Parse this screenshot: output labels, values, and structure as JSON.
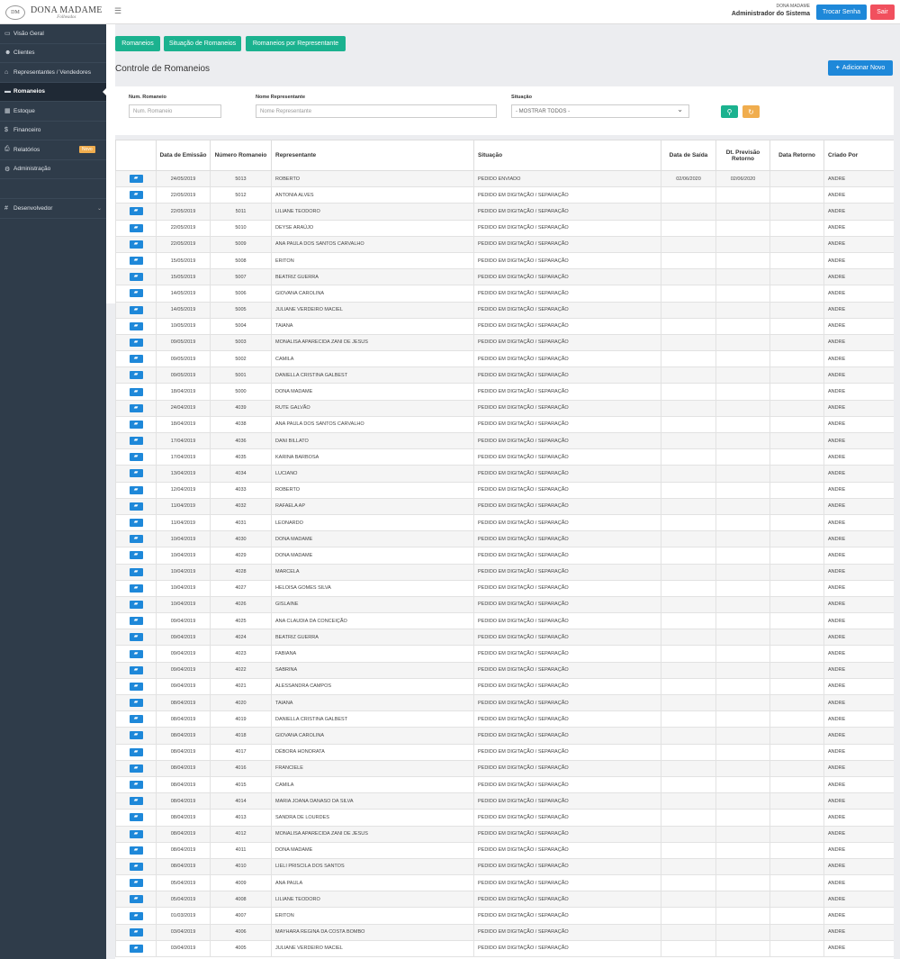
{
  "header": {
    "brand": "DONA MADAME",
    "brand_sub": "Folheados",
    "menu_icon": "hamburger-icon",
    "user_small": "DONA MADAME",
    "user_role": "Administrador do Sistema",
    "btn_change_password": "Trocar Senha",
    "btn_logout": "Sair",
    "colors": {
      "primary": "#1e88d9",
      "danger": "#f1505e",
      "success": "#1bb28f",
      "warning": "#f0ad4e"
    }
  },
  "sidebar": {
    "items": [
      {
        "label": "Visão Geral",
        "icon": "monitor-icon"
      },
      {
        "label": "Clientes",
        "icon": "users-icon"
      },
      {
        "label": "Representantes / Vendedores",
        "icon": "bank-icon"
      },
      {
        "label": "Romaneios",
        "icon": "briefcase-icon"
      },
      {
        "label": "Estoque",
        "icon": "grid-icon"
      },
      {
        "label": "Financeiro",
        "icon": "dollar-icon"
      },
      {
        "label": "Relatórios",
        "icon": "print-icon",
        "badge": "Novo"
      },
      {
        "label": "Administração",
        "icon": "gear-icon"
      }
    ],
    "developer": {
      "label": "Desenvolvedor",
      "icon": "hash-icon"
    }
  },
  "main": {
    "tabs": [
      "Romaneios",
      "Situação de Romaneios",
      "Romaneios por Representante"
    ],
    "title": "Controle de Romaneios",
    "add_button": "Adicionar Novo",
    "filters": {
      "num_label": "Num. Romaneio",
      "num_placeholder": "Num. Romaneio",
      "rep_label": "Nome Representante",
      "rep_placeholder": "Nome Representante",
      "status_label": "Situação",
      "status_value": "- MOSTRAR TODOS -"
    },
    "table": {
      "headers": [
        "",
        "Data de Emissão",
        "Número Romaneio",
        "Representante",
        "Situação",
        "Data de Saída",
        "Dt. Previsão Retorno",
        "Data Retorno",
        "Criado Por"
      ],
      "rows": [
        [
          "24/05/2019",
          "5013",
          "ROBERTO",
          "PEDIDO ENVIADO",
          "02/06/2020",
          "02/06/2020",
          "",
          "ANDRE"
        ],
        [
          "22/05/2019",
          "5012",
          "ANTONIA ALVES",
          "PEDIDO EM DIGITAÇÃO / SEPARAÇÃO",
          "",
          "",
          "",
          "ANDRE"
        ],
        [
          "22/05/2019",
          "5011",
          "LILIANE TEODORO",
          "PEDIDO EM DIGITAÇÃO / SEPARAÇÃO",
          "",
          "",
          "",
          "ANDRE"
        ],
        [
          "22/05/2019",
          "5010",
          "DEYSE ARAÚJO",
          "PEDIDO EM DIGITAÇÃO / SEPARAÇÃO",
          "",
          "",
          "",
          "ANDRE"
        ],
        [
          "22/05/2019",
          "5009",
          "ANA PAULA DOS SANTOS CARVALHO",
          "PEDIDO EM DIGITAÇÃO / SEPARAÇÃO",
          "",
          "",
          "",
          "ANDRE"
        ],
        [
          "15/05/2019",
          "5008",
          "ERITON",
          "PEDIDO EM DIGITAÇÃO / SEPARAÇÃO",
          "",
          "",
          "",
          "ANDRE"
        ],
        [
          "15/05/2019",
          "5007",
          "BEATRIZ GUERRA",
          "PEDIDO EM DIGITAÇÃO / SEPARAÇÃO",
          "",
          "",
          "",
          "ANDRE"
        ],
        [
          "14/05/2019",
          "5006",
          "GIOVANA CAROLINA",
          "PEDIDO EM DIGITAÇÃO / SEPARAÇÃO",
          "",
          "",
          "",
          "ANDRE"
        ],
        [
          "14/05/2019",
          "5005",
          "JULIANE VERDEIRO MACIEL",
          "PEDIDO EM DIGITAÇÃO / SEPARAÇÃO",
          "",
          "",
          "",
          "ANDRE"
        ],
        [
          "10/05/2019",
          "5004",
          "TAIANA",
          "PEDIDO EM DIGITAÇÃO / SEPARAÇÃO",
          "",
          "",
          "",
          "ANDRE"
        ],
        [
          "09/05/2019",
          "5003",
          "MONALISA APARECIDA ZANI DE JESUS",
          "PEDIDO EM DIGITAÇÃO / SEPARAÇÃO",
          "",
          "",
          "",
          "ANDRE"
        ],
        [
          "09/05/2019",
          "5002",
          "CAMILA",
          "PEDIDO EM DIGITAÇÃO / SEPARAÇÃO",
          "",
          "",
          "",
          "ANDRE"
        ],
        [
          "09/05/2019",
          "5001",
          "DANIELLA CRISTINA GALBEST",
          "PEDIDO EM DIGITAÇÃO / SEPARAÇÃO",
          "",
          "",
          "",
          "ANDRE"
        ],
        [
          "18/04/2019",
          "5000",
          "DONA MADAME",
          "PEDIDO EM DIGITAÇÃO / SEPARAÇÃO",
          "",
          "",
          "",
          "ANDRE"
        ],
        [
          "24/04/2019",
          "4039",
          "RUTE GALVÃO",
          "PEDIDO EM DIGITAÇÃO / SEPARAÇÃO",
          "",
          "",
          "",
          "ANDRE"
        ],
        [
          "18/04/2019",
          "4038",
          "ANA PAULA DOS SANTOS CARVALHO",
          "PEDIDO EM DIGITAÇÃO / SEPARAÇÃO",
          "",
          "",
          "",
          "ANDRE"
        ],
        [
          "17/04/2019",
          "4036",
          "DANI BILLATO",
          "PEDIDO EM DIGITAÇÃO / SEPARAÇÃO",
          "",
          "",
          "",
          "ANDRE"
        ],
        [
          "17/04/2019",
          "4035",
          "KARINA BARBOSA",
          "PEDIDO EM DIGITAÇÃO / SEPARAÇÃO",
          "",
          "",
          "",
          "ANDRE"
        ],
        [
          "13/04/2019",
          "4034",
          "LUCIANO",
          "PEDIDO EM DIGITAÇÃO / SEPARAÇÃO",
          "",
          "",
          "",
          "ANDRE"
        ],
        [
          "12/04/2019",
          "4033",
          "ROBERTO",
          "PEDIDO EM DIGITAÇÃO / SEPARAÇÃO",
          "",
          "",
          "",
          "ANDRE"
        ],
        [
          "11/04/2019",
          "4032",
          "RAFAELA AP",
          "PEDIDO EM DIGITAÇÃO / SEPARAÇÃO",
          "",
          "",
          "",
          "ANDRE"
        ],
        [
          "11/04/2019",
          "4031",
          "LEONARDO",
          "PEDIDO EM DIGITAÇÃO / SEPARAÇÃO",
          "",
          "",
          "",
          "ANDRE"
        ],
        [
          "10/04/2019",
          "4030",
          "DONA MADAME",
          "PEDIDO EM DIGITAÇÃO / SEPARAÇÃO",
          "",
          "",
          "",
          "ANDRE"
        ],
        [
          "10/04/2019",
          "4029",
          "DONA MADAME",
          "PEDIDO EM DIGITAÇÃO / SEPARAÇÃO",
          "",
          "",
          "",
          "ANDRE"
        ],
        [
          "10/04/2019",
          "4028",
          "MARCELA",
          "PEDIDO EM DIGITAÇÃO / SEPARAÇÃO",
          "",
          "",
          "",
          "ANDRE"
        ],
        [
          "10/04/2019",
          "4027",
          "HELOISA GOMES SILVA",
          "PEDIDO EM DIGITAÇÃO / SEPARAÇÃO",
          "",
          "",
          "",
          "ANDRE"
        ],
        [
          "10/04/2019",
          "4026",
          "GISLAINE",
          "PEDIDO EM DIGITAÇÃO / SEPARAÇÃO",
          "",
          "",
          "",
          "ANDRE"
        ],
        [
          "09/04/2019",
          "4025",
          "ANA CLAUDIA DA CONCEIÇÃO",
          "PEDIDO EM DIGITAÇÃO / SEPARAÇÃO",
          "",
          "",
          "",
          "ANDRE"
        ],
        [
          "09/04/2019",
          "4024",
          "BEATRIZ GUERRA",
          "PEDIDO EM DIGITAÇÃO / SEPARAÇÃO",
          "",
          "",
          "",
          "ANDRE"
        ],
        [
          "09/04/2019",
          "4023",
          "FABIANA",
          "PEDIDO EM DIGITAÇÃO / SEPARAÇÃO",
          "",
          "",
          "",
          "ANDRE"
        ],
        [
          "09/04/2019",
          "4022",
          "SABRINA",
          "PEDIDO EM DIGITAÇÃO / SEPARAÇÃO",
          "",
          "",
          "",
          "ANDRE"
        ],
        [
          "09/04/2019",
          "4021",
          "ALESSANDRA CAMPOS",
          "PEDIDO EM DIGITAÇÃO / SEPARAÇÃO",
          "",
          "",
          "",
          "ANDRE"
        ],
        [
          "08/04/2019",
          "4020",
          "TAIANA",
          "PEDIDO EM DIGITAÇÃO / SEPARAÇÃO",
          "",
          "",
          "",
          "ANDRE"
        ],
        [
          "08/04/2019",
          "4019",
          "DANIELLA CRISTINA GALBEST",
          "PEDIDO EM DIGITAÇÃO / SEPARAÇÃO",
          "",
          "",
          "",
          "ANDRE"
        ],
        [
          "08/04/2019",
          "4018",
          "GIOVANA CAROLINA",
          "PEDIDO EM DIGITAÇÃO / SEPARAÇÃO",
          "",
          "",
          "",
          "ANDRE"
        ],
        [
          "08/04/2019",
          "4017",
          "DÉBORA HONORATA",
          "PEDIDO EM DIGITAÇÃO / SEPARAÇÃO",
          "",
          "",
          "",
          "ANDRE"
        ],
        [
          "08/04/2019",
          "4016",
          "FRANCIELE",
          "PEDIDO EM DIGITAÇÃO / SEPARAÇÃO",
          "",
          "",
          "",
          "ANDRE"
        ],
        [
          "08/04/2019",
          "4015",
          "CAMILA",
          "PEDIDO EM DIGITAÇÃO / SEPARAÇÃO",
          "",
          "",
          "",
          "ANDRE"
        ],
        [
          "08/04/2019",
          "4014",
          "MARIA JOANA DANASO DA SILVA",
          "PEDIDO EM DIGITAÇÃO / SEPARAÇÃO",
          "",
          "",
          "",
          "ANDRE"
        ],
        [
          "08/04/2019",
          "4013",
          "SANDRA DE LOURDES",
          "PEDIDO EM DIGITAÇÃO / SEPARAÇÃO",
          "",
          "",
          "",
          "ANDRE"
        ],
        [
          "08/04/2019",
          "4012",
          "MONALISA APARECIDA ZANI DE JESUS",
          "PEDIDO EM DIGITAÇÃO / SEPARAÇÃO",
          "",
          "",
          "",
          "ANDRE"
        ],
        [
          "08/04/2019",
          "4011",
          "DONA MADAME",
          "PEDIDO EM DIGITAÇÃO / SEPARAÇÃO",
          "",
          "",
          "",
          "ANDRE"
        ],
        [
          "08/04/2019",
          "4010",
          "LIELI PRISCILA DOS SANTOS",
          "PEDIDO EM DIGITAÇÃO / SEPARAÇÃO",
          "",
          "",
          "",
          "ANDRE"
        ],
        [
          "05/04/2019",
          "4009",
          "ANA PAULA",
          "PEDIDO EM DIGITAÇÃO / SEPARAÇÃO",
          "",
          "",
          "",
          "ANDRE"
        ],
        [
          "05/04/2019",
          "4008",
          "LILIANE TEODORO",
          "PEDIDO EM DIGITAÇÃO / SEPARAÇÃO",
          "",
          "",
          "",
          "ANDRE"
        ],
        [
          "01/03/2019",
          "4007",
          "ERITON",
          "PEDIDO EM DIGITAÇÃO / SEPARAÇÃO",
          "",
          "",
          "",
          "ANDRE"
        ],
        [
          "03/04/2019",
          "4006",
          "MAYHARA REGINA DA COSTA BOMBO",
          "PEDIDO EM DIGITAÇÃO / SEPARAÇÃO",
          "",
          "",
          "",
          "ANDRE"
        ],
        [
          "03/04/2019",
          "4005",
          "JULIANE VERDEIRO MACIEL",
          "PEDIDO EM DIGITAÇÃO / SEPARAÇÃO",
          "",
          "",
          "",
          "ANDRE"
        ]
      ]
    }
  }
}
